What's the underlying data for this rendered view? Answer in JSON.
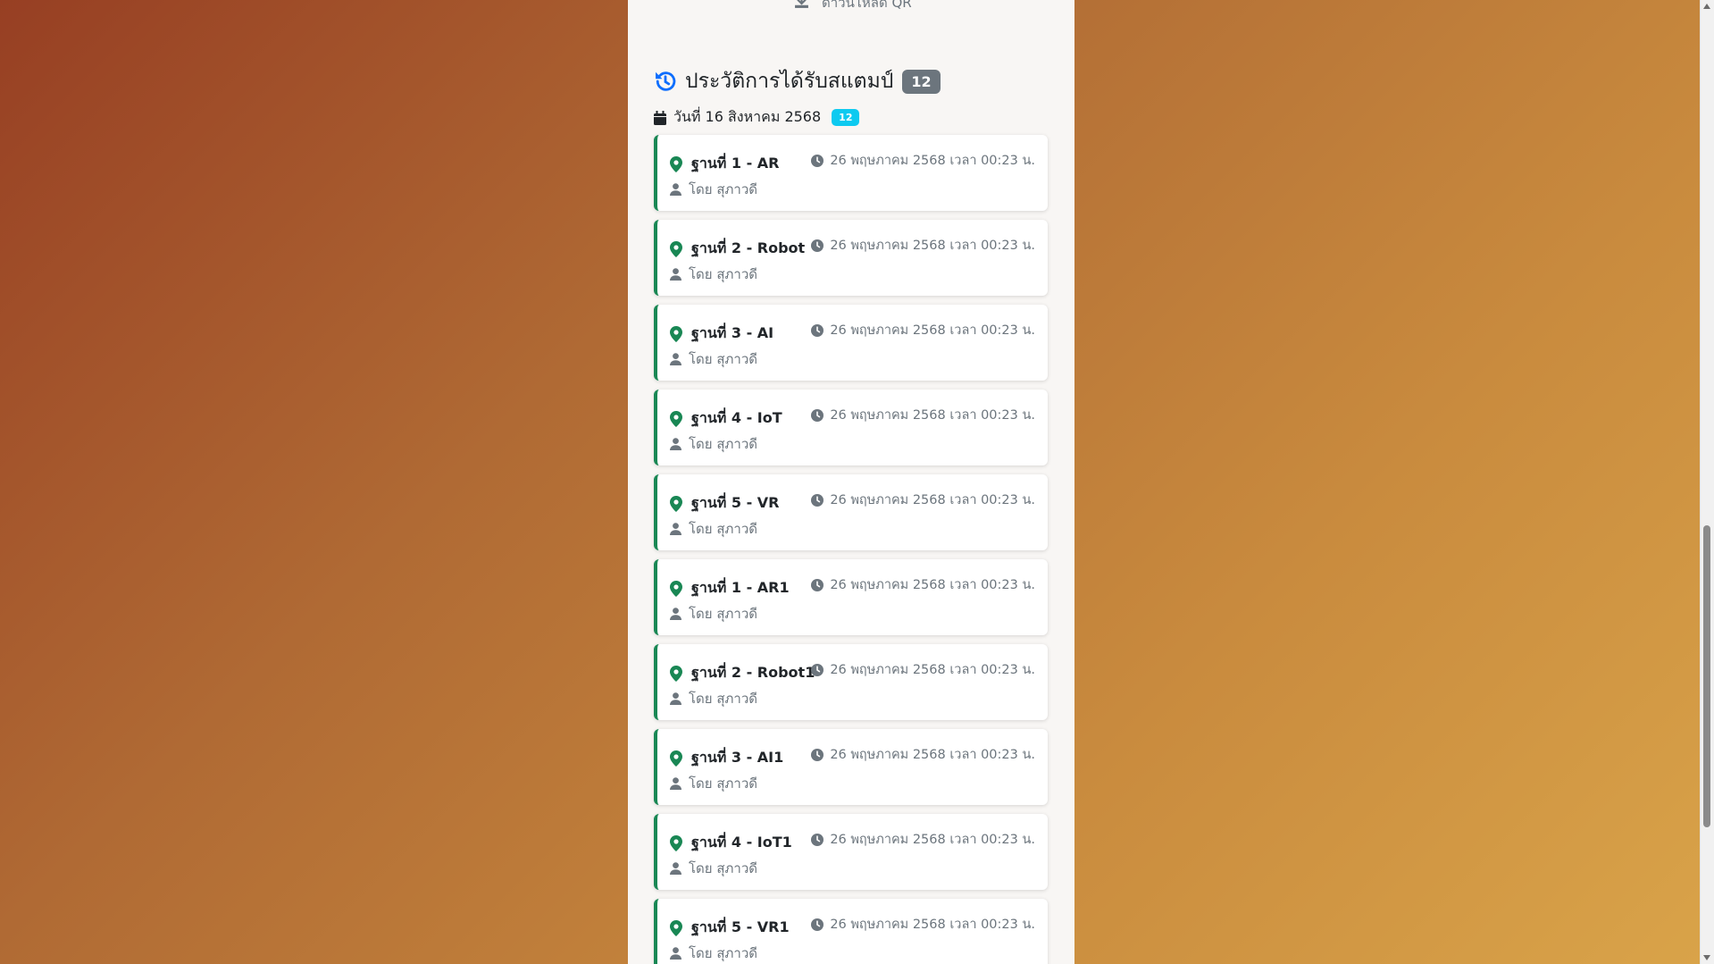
{
  "qr": {
    "label": "ดาวน์โหลด QR"
  },
  "history": {
    "title": "ประวัติการได้รับสแตมป์",
    "count": "12",
    "date_label": "วันที่ 16 สิงหาคม 2568",
    "date_count": "12"
  },
  "stamps": [
    {
      "station": "ฐานที่ 1 - AR",
      "by": "โดย สุภาวดี",
      "time": "26 พฤษภาคม 2568 เวลา 00:23 น."
    },
    {
      "station": "ฐานที่ 2 - Robot",
      "by": "โดย สุภาวดี",
      "time": "26 พฤษภาคม 2568 เวลา 00:23 น."
    },
    {
      "station": "ฐานที่ 3 - AI",
      "by": "โดย สุภาวดี",
      "time": "26 พฤษภาคม 2568 เวลา 00:23 น."
    },
    {
      "station": "ฐานที่ 4 - IoT",
      "by": "โดย สุภาวดี",
      "time": "26 พฤษภาคม 2568 เวลา 00:23 น."
    },
    {
      "station": "ฐานที่ 5 - VR",
      "by": "โดย สุภาวดี",
      "time": "26 พฤษภาคม 2568 เวลา 00:23 น."
    },
    {
      "station": "ฐานที่ 1 - AR1",
      "by": "โดย สุภาวดี",
      "time": "26 พฤษภาคม 2568 เวลา 00:23 น."
    },
    {
      "station": "ฐานที่ 2 - Robot1",
      "by": "โดย สุภาวดี",
      "time": "26 พฤษภาคม 2568 เวลา 00:23 น."
    },
    {
      "station": "ฐานที่ 3 - AI1",
      "by": "โดย สุภาวดี",
      "time": "26 พฤษภาคม 2568 เวลา 00:23 น."
    },
    {
      "station": "ฐานที่ 4 - IoT1",
      "by": "โดย สุภาวดี",
      "time": "26 พฤษภาคม 2568 เวลา 00:23 น."
    },
    {
      "station": "ฐานที่ 5 - VR1",
      "by": "โดย สุภาวดี",
      "time": "26 พฤษภาคม 2568 เวลา 00:23 น."
    }
  ],
  "icons": {
    "history": "history-icon",
    "calendar": "calendar-icon",
    "location": "map-pin-icon",
    "user": "user-icon",
    "clock": "clock-icon",
    "download": "download-icon"
  },
  "colors": {
    "history_icon": "#0d6efd",
    "card_accent": "#198754",
    "count_badge": "#6c757d",
    "date_badge": "#0dcaf0"
  }
}
